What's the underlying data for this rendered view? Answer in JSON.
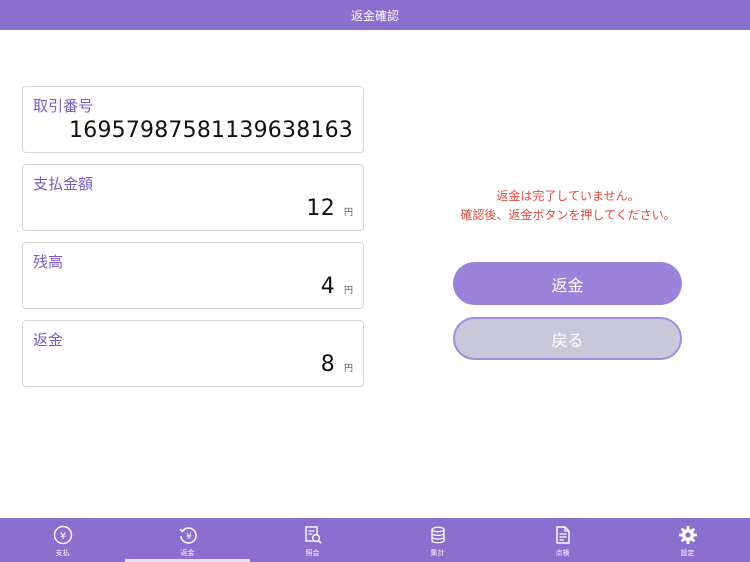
{
  "header": {
    "title": "返金確認"
  },
  "fields": {
    "transaction": {
      "label": "取引番号",
      "value": "1695798758113963816​3"
    },
    "payment": {
      "label": "支払金額",
      "value": "12",
      "unit": "円"
    },
    "balance": {
      "label": "残高",
      "value": "4",
      "unit": "円"
    },
    "refund": {
      "label": "返金",
      "value": "8",
      "unit": "円"
    }
  },
  "message": {
    "line1": "返金は完了していません。",
    "line2": "確認後、返金ボタンを押してください。"
  },
  "buttons": {
    "refund": "返金",
    "back": "戻る"
  },
  "tabs": [
    {
      "label": "支払",
      "icon": "yen-coin-icon"
    },
    {
      "label": "返金",
      "icon": "refund-yen-icon"
    },
    {
      "label": "照会",
      "icon": "inquiry-icon"
    },
    {
      "label": "集計",
      "icon": "coin-stack-icon"
    },
    {
      "label": "点検",
      "icon": "document-icon"
    },
    {
      "label": "設定",
      "icon": "gear-icon"
    }
  ],
  "colors": {
    "accent": "#8a6fcf",
    "warning": "#e04a3f",
    "label": "#7a5bc6"
  }
}
